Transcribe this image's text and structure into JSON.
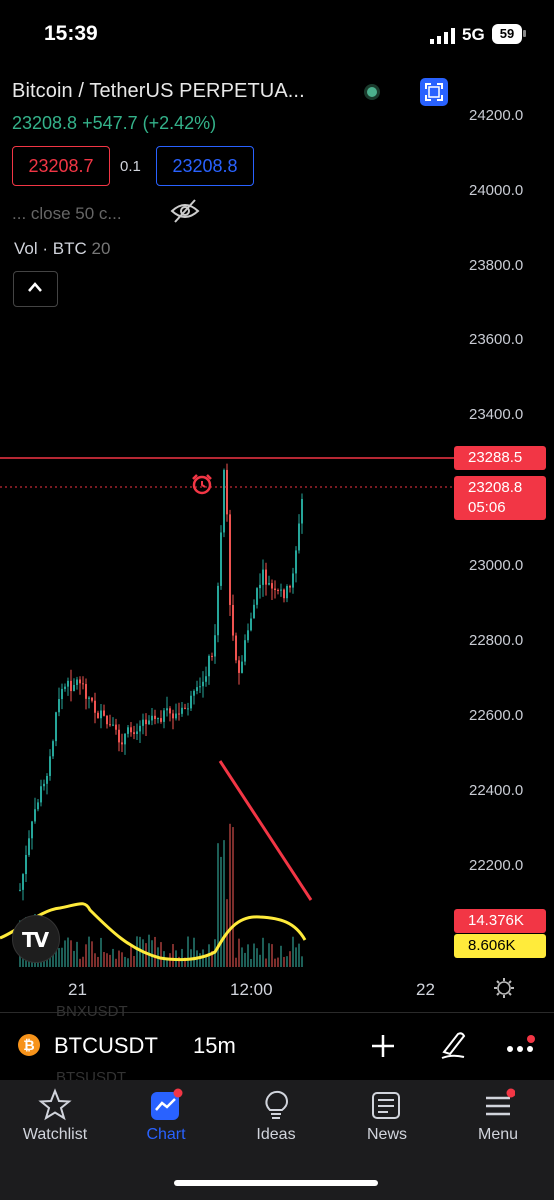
{
  "status_bar": {
    "time": "15:39",
    "network": "5G",
    "battery": "59"
  },
  "header": {
    "symbol_title": "Bitcoin / TetherUS PERPETUA...",
    "price_change": "23208.8 +547.7 (+2.42%)",
    "bid": "23208.7",
    "spread": "0.1",
    "ask": "23208.8",
    "indicator_label": "...   close 50 c...",
    "volume_label": "Vol · BTC",
    "volume_value": "20"
  },
  "price_axis": {
    "labels": [
      "24200.0",
      "24000.0",
      "23800.0",
      "23600.0",
      "23400.0",
      "23000.0",
      "22800.0",
      "22600.0",
      "22400.0",
      "22200.0"
    ],
    "alert_price": "23288.5",
    "last_price": "23208.8",
    "countdown": "05:06",
    "volume_tag": "14.376K",
    "ma_tag": "8.606K"
  },
  "time_axis": {
    "labels": [
      "21",
      "12:00",
      "22"
    ]
  },
  "colors": {
    "up": "#26a69a",
    "down": "#ef5350",
    "accent": "#2962ff",
    "volume_ma": "#ffeb3b"
  },
  "toolbar": {
    "ticker": "BTCUSDT",
    "ghost_prev": "BNXUSDT",
    "ghost_next": "BTSUSDT",
    "timeframe": "15m",
    "coin_glyph": "₿"
  },
  "nav": [
    {
      "label": "Watchlist",
      "icon": "star-icon"
    },
    {
      "label": "Chart",
      "icon": "chart-icon"
    },
    {
      "label": "Ideas",
      "icon": "lightbulb-icon"
    },
    {
      "label": "News",
      "icon": "news-icon"
    },
    {
      "label": "Menu",
      "icon": "menu-icon"
    }
  ],
  "logo": "TV"
}
